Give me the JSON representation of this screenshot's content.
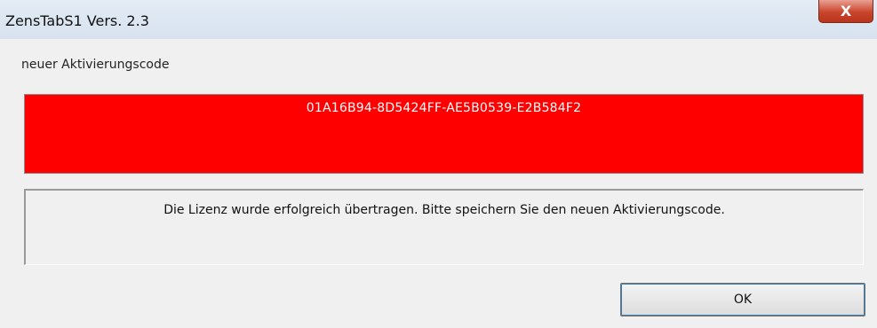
{
  "window": {
    "title": "ZensTabS1 Vers. 2.3",
    "close_icon": "close-icon",
    "close_glyph": "X"
  },
  "activation": {
    "label": "neuer Aktivierungscode",
    "code": "01A16B94-8D5424FF-AE5B0539-E2B584F2",
    "field_color": "#ff0000"
  },
  "message": {
    "text": "Die Lizenz wurde erfolgreich übertragen. Bitte speichern Sie den neuen Aktivierungscode."
  },
  "buttons": {
    "ok_label": "OK"
  }
}
